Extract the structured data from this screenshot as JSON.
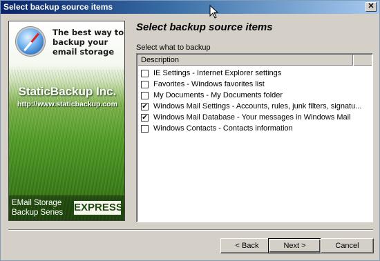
{
  "window": {
    "title": "Select backup source items",
    "close_glyph": "✕"
  },
  "side_panel": {
    "tagline": "The best way to backup your email storage",
    "brand": "StaticBackup Inc.",
    "url": "http://www.staticbackup.com",
    "series_line1": "EMail Storage",
    "series_line2": "Backup Series",
    "badge": "EXPRESS",
    "logo_icon": "compass-icon"
  },
  "page": {
    "heading": "Select backup source items",
    "prompt": "Select what to backup"
  },
  "list": {
    "column": "Description",
    "items": [
      {
        "label": "IE Settings - Internet Explorer settings",
        "checked": false
      },
      {
        "label": "Favorites - Windows favorites list",
        "checked": false
      },
      {
        "label": "My Documents - My Documents folder",
        "checked": false
      },
      {
        "label": "Windows Mail Settings - Accounts, rules, junk filters, signatu...",
        "checked": true
      },
      {
        "label": "Windows Mail Database - Your messages in Windows Mail",
        "checked": true
      },
      {
        "label": "Windows Contacts - Contacts information",
        "checked": false
      }
    ]
  },
  "buttons": {
    "back": "< Back",
    "next": "Next >",
    "cancel": "Cancel"
  }
}
